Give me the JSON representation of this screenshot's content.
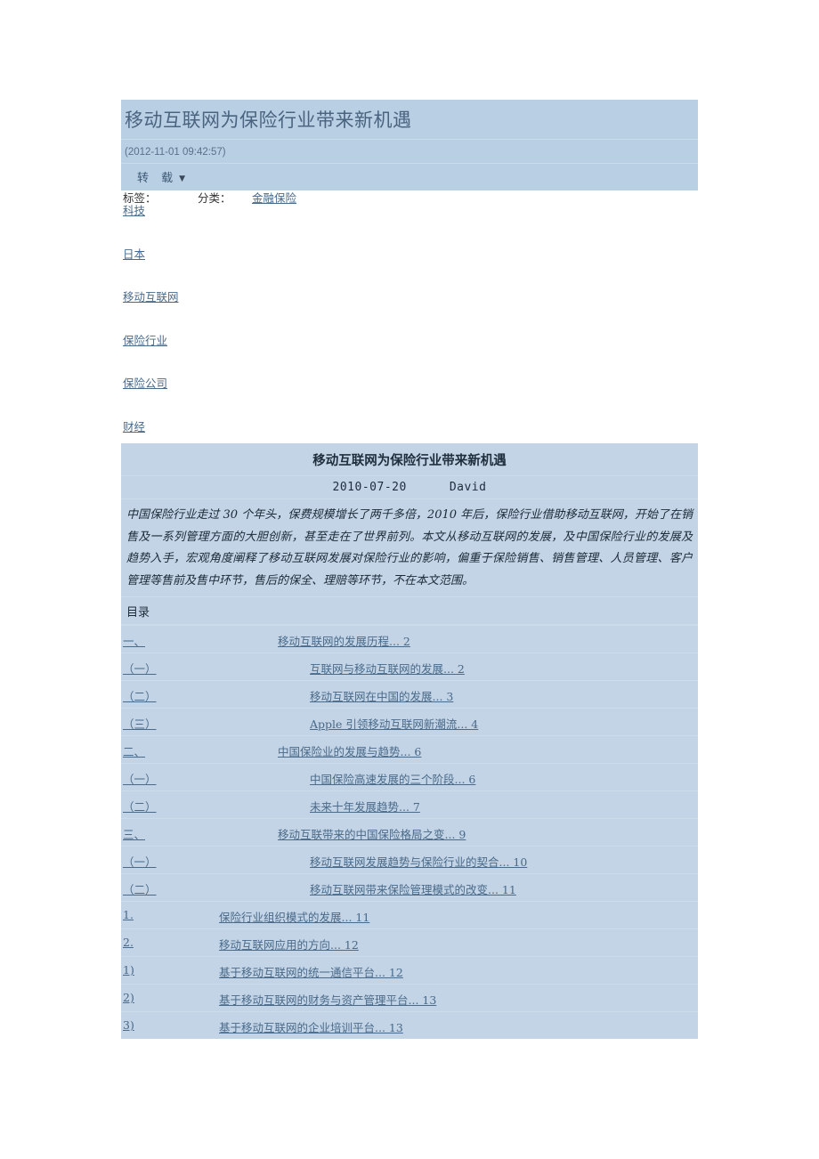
{
  "post": {
    "title": "移动互联网为保险行业带来新机遇",
    "date": "(2012-11-01 09:42:57)",
    "repost_label": "转 载",
    "caret": "▼"
  },
  "taxonomy": {
    "tags_label": "标签：",
    "categories_label": "分类：",
    "category": "金融保险",
    "tags": [
      "科技",
      "日本",
      "移动互联网",
      "保险行业",
      "保险公司",
      "财经"
    ]
  },
  "document": {
    "title": "移动互联网为保险行业带来新机遇",
    "date": "2010-07-20",
    "author": "David",
    "abstract": "中国保险行业走过 30 个年头，保费规模增长了两千多倍，2010 年后，保险行业借助移动互联网，开始了在销售及一系列管理方面的大胆创新，甚至走在了世界前列。本文从移动互联网的发展，及中国保险行业的发展及趋势入手，宏观角度阐释了移动互联网发展对保险行业的影响，偏重于保险销售、销售管理、人员管理、客户管理等售前及售中环节，售后的保全、理赔等环节，不在本文范围。",
    "toc_heading": "目录",
    "toc": [
      {
        "level": 1,
        "num": "一、",
        "text": "移动互联网的发展历程",
        "dots": "...",
        "page": "2"
      },
      {
        "level": 2,
        "num": "（一）",
        "text": "互联网与移动互联网的发展",
        "dots": "...",
        "page": "2"
      },
      {
        "level": 2,
        "num": "（二）",
        "text": "移动互联网在中国的发展",
        "dots": "...",
        "page": "3"
      },
      {
        "level": 2,
        "num": "（三）",
        "text": "Apple 引领移动互联网新潮流",
        "dots": "...",
        "page": "4"
      },
      {
        "level": 1,
        "num": "二、",
        "text": "中国保险业的发展与趋势",
        "dots": "...",
        "page": "6"
      },
      {
        "level": 2,
        "num": "（一）",
        "text": "中国保险高速发展的三个阶段",
        "dots": "...",
        "page": "6"
      },
      {
        "level": 2,
        "num": "（二）",
        "text": "未来十年发展趋势",
        "dots": "...",
        "page": "7"
      },
      {
        "level": 1,
        "num": "三、",
        "text": "移动互联带来的中国保险格局之变",
        "dots": "...",
        "page": "9"
      },
      {
        "level": 2,
        "num": "（一）",
        "text": "移动互联网发展趋势与保险行业的契合",
        "dots": "...",
        "page": "10"
      },
      {
        "level": 2,
        "num": "（二）",
        "text": "移动互联网带来保险管理模式的改变",
        "dots": "...",
        "page": "11"
      },
      {
        "level": 3,
        "num": "1.",
        "text": "保险行业组织模式的发展",
        "dots": "...",
        "page": "11"
      },
      {
        "level": 3,
        "num": "2.",
        "text": "移动互联网应用的方向",
        "dots": "...",
        "page": "12"
      },
      {
        "level": 4,
        "num": "1)",
        "text": "基于移动互联网的统一通信平台",
        "dots": "...",
        "page": "12"
      },
      {
        "level": 4,
        "num": "2)",
        "text": "基于移动互联网的财务与资产管理平台",
        "dots": "...",
        "page": "13"
      },
      {
        "level": 4,
        "num": "3)",
        "text": "基于移动互联网的企业培训平台",
        "dots": "...",
        "page": "13"
      }
    ]
  },
  "colors": {
    "header_band": "#b9cfe3",
    "doc_background": "#c2d4e5",
    "link": "#4a6a8a",
    "title": "#4a6480",
    "page_background": "#ffffff"
  }
}
